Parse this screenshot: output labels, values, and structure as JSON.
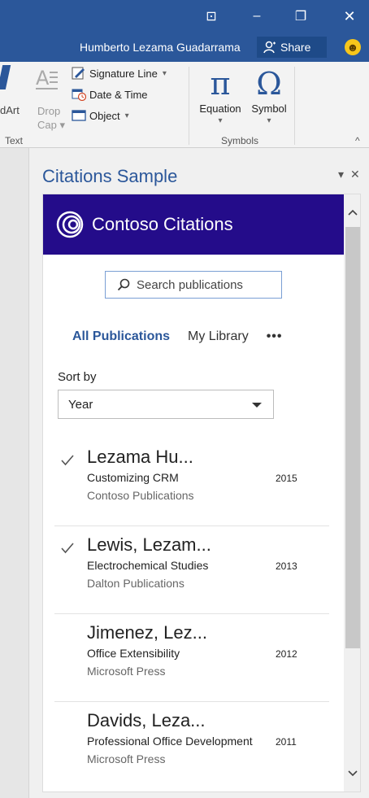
{
  "window": {
    "user_name": "Humberto Lezama Guadarrama",
    "share_label": "Share",
    "ribbon_toggle_glyph": "⊡",
    "minimize_glyph": "–",
    "restore_glyph": "❐",
    "close_glyph": "✕"
  },
  "ribbon": {
    "wordart_partial_label": "dArt",
    "dropcap_label_line1": "Drop",
    "dropcap_label_line2": "Cap",
    "signature_line": "Signature Line",
    "date_time": "Date & Time",
    "object": "Object",
    "text_group": "Text",
    "equation": "Equation",
    "symbol": "Symbol",
    "symbols_group": "Symbols",
    "equation_glyph": "π",
    "symbol_glyph": "Ω"
  },
  "taskpane": {
    "title": "Citations Sample",
    "menu_glyph": "▾",
    "close_glyph": "✕"
  },
  "addin": {
    "brand_name": "Contoso Citations",
    "search_placeholder": "Search publications",
    "tabs": {
      "all": "All Publications",
      "library": "My Library",
      "more": "•••"
    },
    "sort_label": "Sort by",
    "sort_value": "Year",
    "publications": [
      {
        "author": "Lezama Hu...",
        "title": "Customizing CRM",
        "year": "2015",
        "publisher": "Contoso Publications",
        "selected": true
      },
      {
        "author": "Lewis, Lezam...",
        "title": "Electrochemical Studies",
        "year": "2013",
        "publisher": "Dalton Publications",
        "selected": true
      },
      {
        "author": "Jimenez, Lez...",
        "title": "Office Extensibility",
        "year": "2012",
        "publisher": "Microsoft Press",
        "selected": false
      },
      {
        "author": "Davids, Leza...",
        "title": "Professional Office Development",
        "year": "2011",
        "publisher": "Microsoft Press",
        "selected": false
      }
    ]
  },
  "colors": {
    "word_blue": "#2b579a",
    "brand_purple": "#240c8a",
    "smiley_yellow": "#f7c61b"
  }
}
